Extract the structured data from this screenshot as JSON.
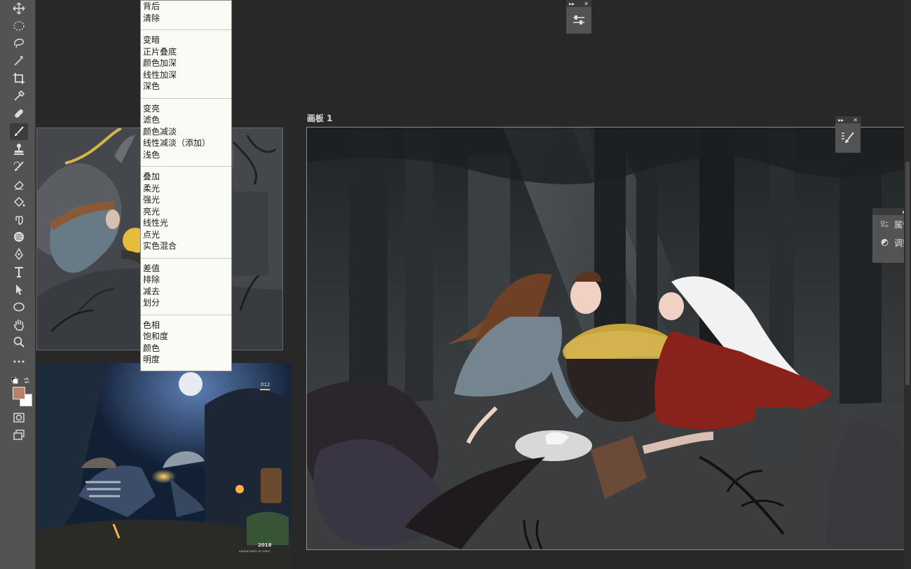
{
  "toolbar": {
    "tools": [
      "move-tool",
      "marquee-tool",
      "lasso-tool",
      "magic-wand-tool",
      "crop-tool",
      "eyedropper-tool",
      "healing-tool",
      "brush-tool",
      "clone-stamp-tool",
      "history-brush-tool",
      "eraser-tool",
      "paint-bucket-tool",
      "smudge-tool",
      "dodge-tool",
      "pen-tool",
      "type-tool",
      "path-select-tool",
      "ellipse-tool",
      "hand-tool",
      "zoom-tool",
      "more-tools"
    ],
    "active": "brush-tool",
    "foreground_color": "#b8826a",
    "background_color": "#ffffff"
  },
  "blend_menu": {
    "groups": [
      [
        "背后",
        "清除"
      ],
      [
        "变暗",
        "正片叠底",
        "颜色加深",
        "线性加深",
        "深色"
      ],
      [
        "变亮",
        "滤色",
        "颜色减淡",
        "线性减淡（添加）",
        "浅色"
      ],
      [
        "叠加",
        "柔光",
        "强光",
        "亮光",
        "线性光",
        "点光",
        "实色混合"
      ],
      [
        "差值",
        "排除",
        "减去",
        "划分"
      ],
      [
        "色相",
        "饱和度",
        "颜色",
        "明度"
      ]
    ]
  },
  "artboard": {
    "label": "画板 1"
  },
  "reference_bottom": {
    "number": "012",
    "year": "2018",
    "caption": "ADVENTURES OF GIRLS"
  },
  "props_panel": {
    "items": [
      {
        "icon": "properties-icon",
        "label": "属性"
      },
      {
        "icon": "adjustments-icon",
        "label": "调整"
      }
    ]
  },
  "panel_controls": {
    "collapse": "▸▸",
    "close": "✕"
  },
  "colors": {
    "app_bg": "#282828",
    "toolbar_bg": "#535353",
    "menu_bg": "#fbfbf6"
  }
}
